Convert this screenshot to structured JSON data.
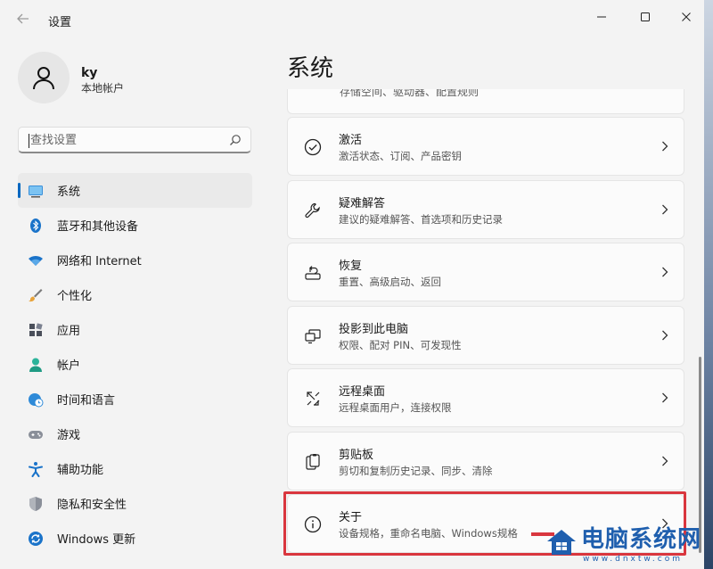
{
  "window": {
    "title": "设置",
    "back_icon": "back-arrow-icon",
    "controls": [
      "minimize-icon",
      "maximize-icon",
      "close-icon"
    ]
  },
  "profile": {
    "name": "ky",
    "account_type": "本地帐户"
  },
  "search": {
    "placeholder": "查找设置",
    "value": ""
  },
  "sidebar": {
    "items": [
      {
        "label": "系统",
        "icon": "display-icon",
        "active": true
      },
      {
        "label": "蓝牙和其他设备",
        "icon": "bluetooth-icon"
      },
      {
        "label": "网络和 Internet",
        "icon": "wifi-icon"
      },
      {
        "label": "个性化",
        "icon": "brush-icon"
      },
      {
        "label": "应用",
        "icon": "apps-icon"
      },
      {
        "label": "帐户",
        "icon": "person-icon"
      },
      {
        "label": "时间和语言",
        "icon": "globe-clock-icon"
      },
      {
        "label": "游戏",
        "icon": "gamepad-icon"
      },
      {
        "label": "辅助功能",
        "icon": "accessibility-icon"
      },
      {
        "label": "隐私和安全性",
        "icon": "shield-icon"
      },
      {
        "label": "Windows 更新",
        "icon": "update-icon"
      }
    ]
  },
  "main": {
    "title": "系统",
    "partial_item_text": "存储空间、驱动器、配置规则",
    "items": [
      {
        "title": "激活",
        "desc": "激活状态、订阅、产品密钥",
        "icon": "check-circle-icon"
      },
      {
        "title": "疑难解答",
        "desc": "建议的疑难解答、首选项和历史记录",
        "icon": "wrench-icon"
      },
      {
        "title": "恢复",
        "desc": "重置、高级启动、返回",
        "icon": "recovery-icon"
      },
      {
        "title": "投影到此电脑",
        "desc": "权限、配对 PIN、可发现性",
        "icon": "project-icon"
      },
      {
        "title": "远程桌面",
        "desc": "远程桌面用户，连接权限",
        "icon": "remote-desktop-icon"
      },
      {
        "title": "剪贴板",
        "desc": "剪切和复制历史记录、同步、清除",
        "icon": "clipboard-icon"
      },
      {
        "title": "关于",
        "desc": "设备规格，重命名电脑、Windows规格",
        "icon": "info-icon",
        "highlighted": true
      }
    ]
  },
  "watermark": {
    "text": "电脑系统网",
    "url": "www.dnxtw.com"
  },
  "colors": {
    "accent": "#0067c0",
    "highlight": "#d9363e",
    "watermark": "#1f5fae"
  }
}
